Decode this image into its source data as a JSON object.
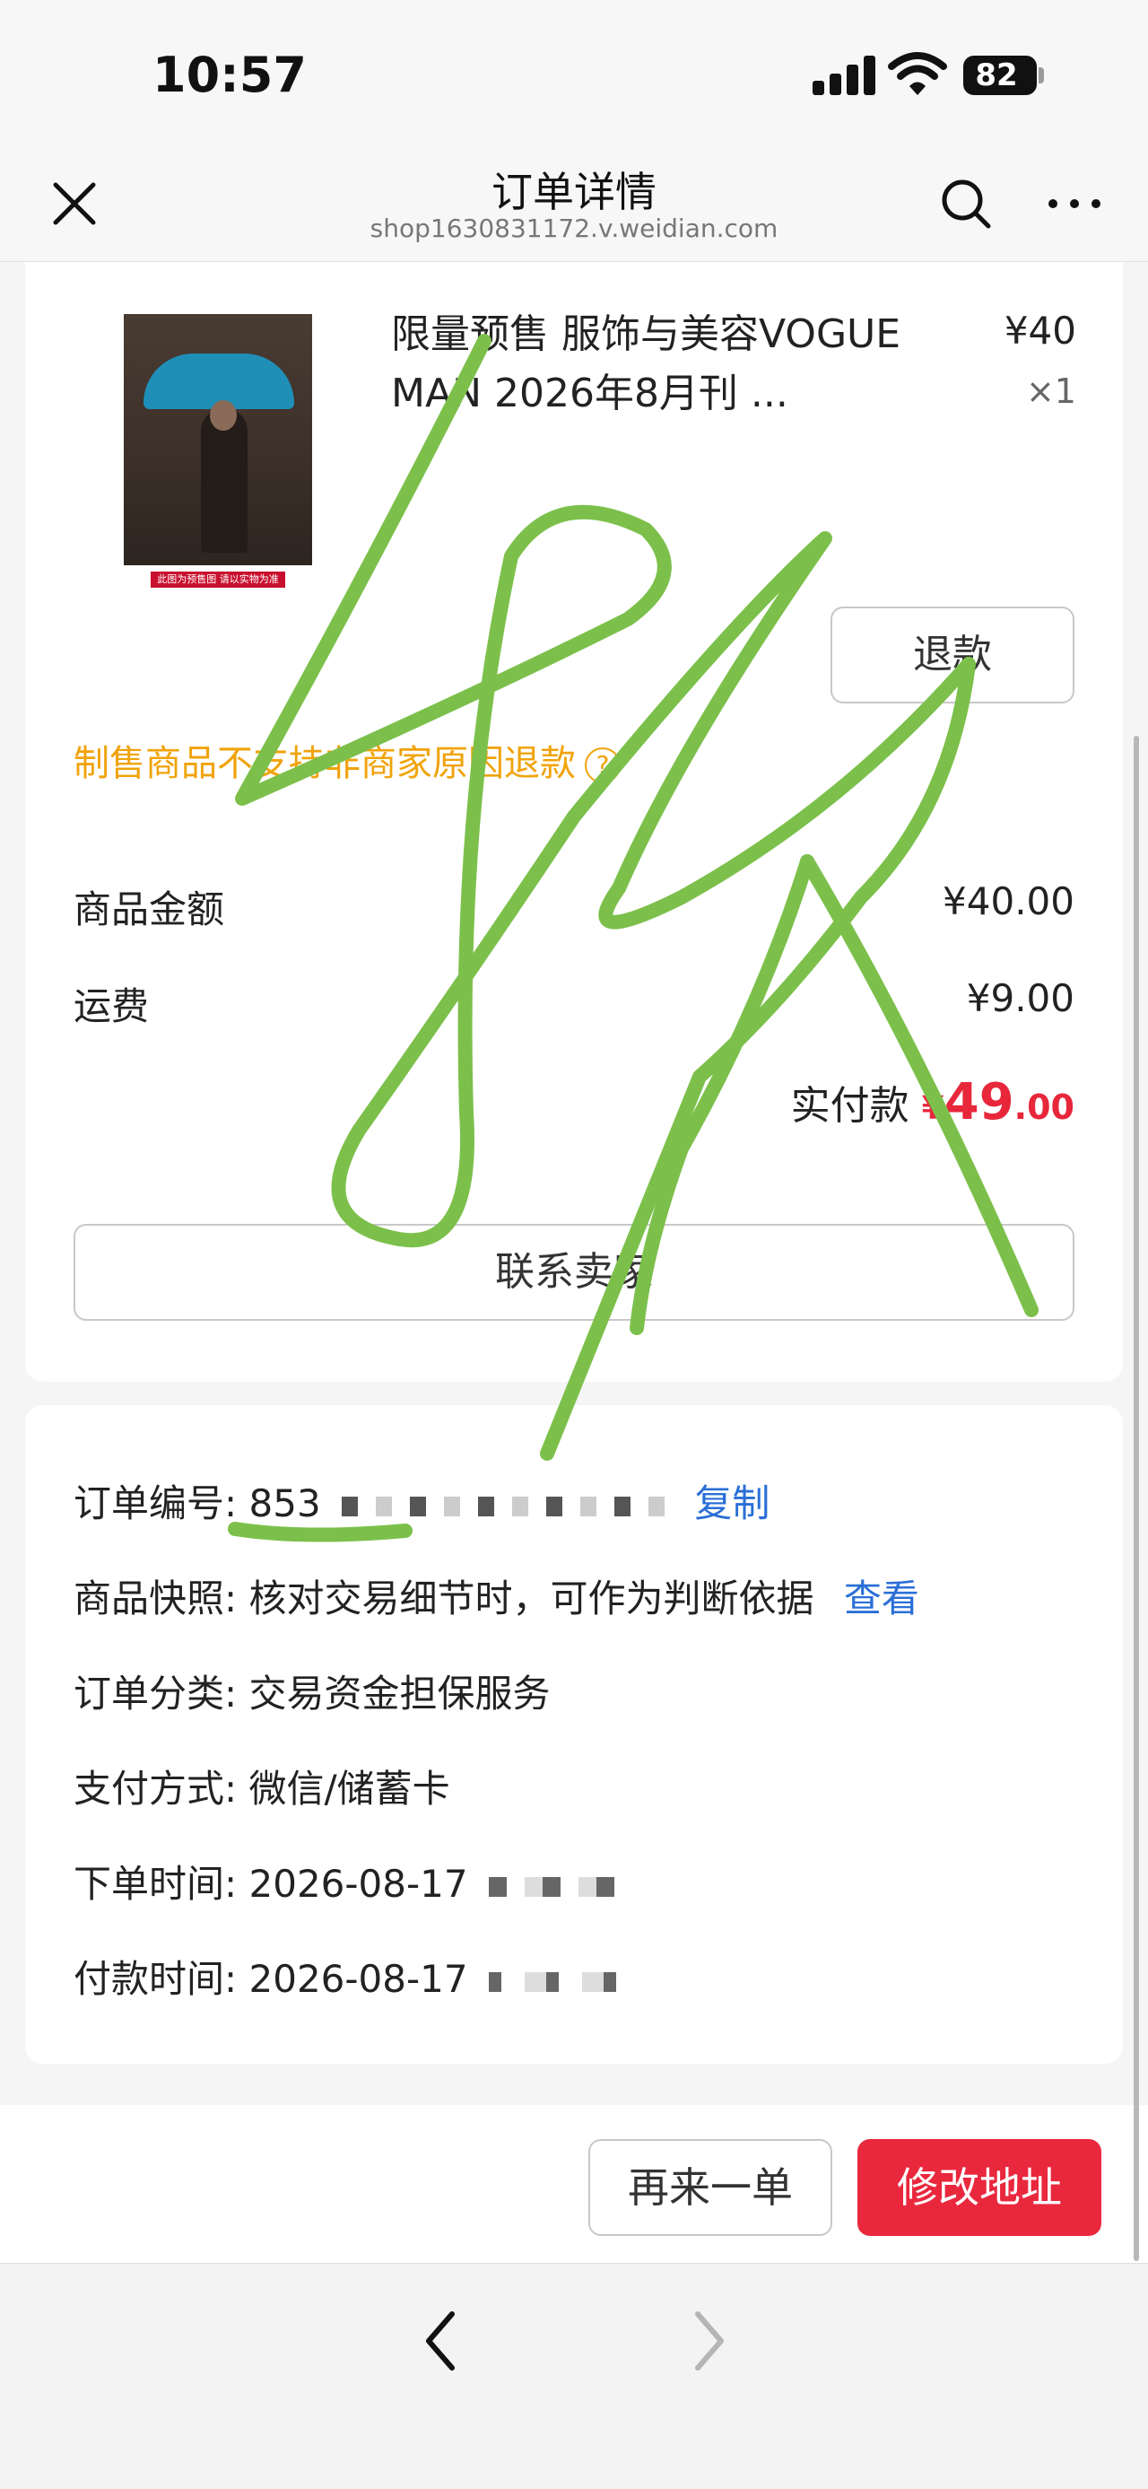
{
  "status_bar": {
    "time": "10:57",
    "battery": "82"
  },
  "nav": {
    "title": "订单详情",
    "subtitle": "shop1630831172.v.weidian.com",
    "icons": [
      "close-icon",
      "search-icon",
      "more-icon"
    ]
  },
  "product": {
    "name": "限量预售 服饰与美容VOGUE MAN 2026年8月刊 ...",
    "price": "¥40",
    "quantity": "×1",
    "image_label": "此图为预售图 请以实物为准"
  },
  "refund_button": "退款",
  "warning": "制售商品不支持非商家原因退款",
  "help_icon_label": "?",
  "amounts": {
    "goods_label": "商品金额",
    "goods_value": "¥40.00",
    "shipping_label": "运费",
    "shipping_value": "¥9.00",
    "paid_label": "实付款",
    "paid_currency": "¥",
    "paid_integer": "49",
    "paid_decimal": ".00"
  },
  "contact_seller_button": "联系卖家",
  "order_info": {
    "order_no_label": "订单编号:",
    "order_no_value": "853",
    "copy_link": "复制",
    "snapshot_label": "商品快照:",
    "snapshot_value": "核对交易细节时，可作为判断依据",
    "snapshot_link": "查看",
    "category_label": "订单分类:",
    "category_value": "交易资金担保服务",
    "payment_label": "支付方式:",
    "payment_value": "微信/储蓄卡",
    "order_time_label": "下单时间:",
    "order_time_value": "2026-08-17",
    "pay_time_label": "付款时间:",
    "pay_time_value": "2026-08-17"
  },
  "bottom_buttons": {
    "again": "再来一单",
    "change_address": "修改地址"
  },
  "colors": {
    "accent_red": "#e9283e",
    "warning_orange": "#f0a30a",
    "link_blue": "#2a6fd6",
    "scribble_green": "#7cc04b"
  }
}
